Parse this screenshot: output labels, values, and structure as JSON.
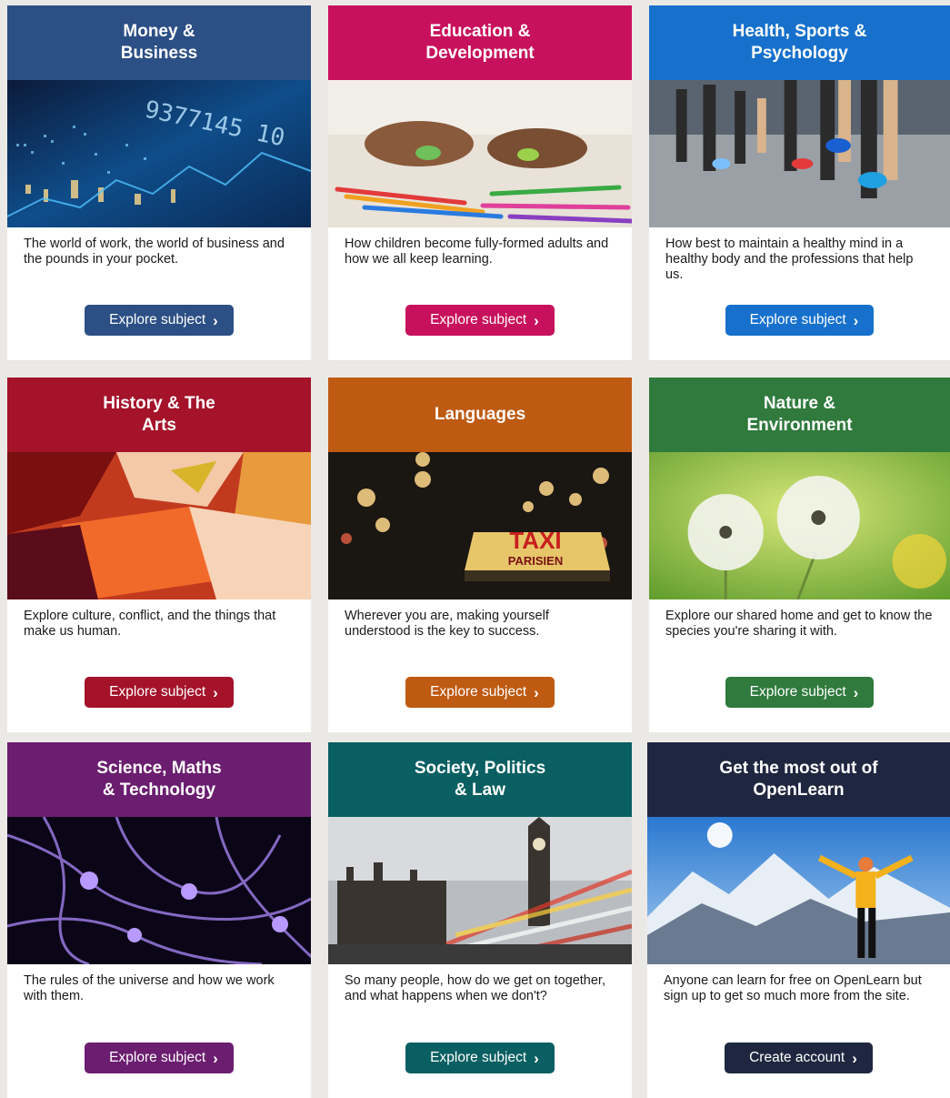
{
  "cards": [
    {
      "title": "Money &\nBusiness",
      "description": "The world of work, the world of business and the pounds in your pocket.",
      "button_label": "Explore subject",
      "color": "#2c4f85",
      "image": "stock-market-city-night"
    },
    {
      "title": "Education &\nDevelopment",
      "description": "How children become fully-formed adults and how we all keep learning.",
      "button_label": "Explore subject",
      "color": "#c8115c",
      "image": "child-painting-hands"
    },
    {
      "title": "Health, Sports &\nPsychology",
      "description": "How best to maintain a healthy mind in a healthy body and the professions that help us.",
      "button_label": "Explore subject",
      "color": "#1771cc",
      "image": "marathon-runners"
    },
    {
      "title": "History & The\nArts",
      "description": "Explore culture, conflict, and the things that make us human.",
      "button_label": "Explore subject",
      "color": "#a4132a",
      "image": "abstract-red-painting"
    },
    {
      "title": "Languages",
      "description": "Wherever you are, making yourself understood is the key to success.",
      "button_label": "Explore subject",
      "color": "#be5a12",
      "image": "paris-taxi-sign",
      "image_text": {
        "sign_main": "TAXI",
        "sign_sub": "PARISIEN"
      }
    },
    {
      "title": "Nature &\nEnvironment",
      "description": "Explore our shared home and get to know the species you're sharing it with.",
      "button_label": "Explore subject",
      "color": "#2f7a3c",
      "image": "dandelion-clocks"
    },
    {
      "title": "Science, Maths\n& Technology",
      "description": "The rules of the universe and how we work with them.",
      "button_label": "Explore subject",
      "color": "#6b1d6f",
      "image": "neurons-network"
    },
    {
      "title": "Society, Politics\n& Law",
      "description": "So many people, how do we get on together, and what happens when we don't?",
      "button_label": "Explore subject",
      "color": "#0a5f62",
      "image": "westminster-bus-blur"
    },
    {
      "title": "Get the most out of\nOpenLearn",
      "description": "Anyone can learn for free on OpenLearn but sign up to get so much more from the site.",
      "button_label": "Create account",
      "color": "#1f2740",
      "image": "hiker-mountains"
    }
  ]
}
